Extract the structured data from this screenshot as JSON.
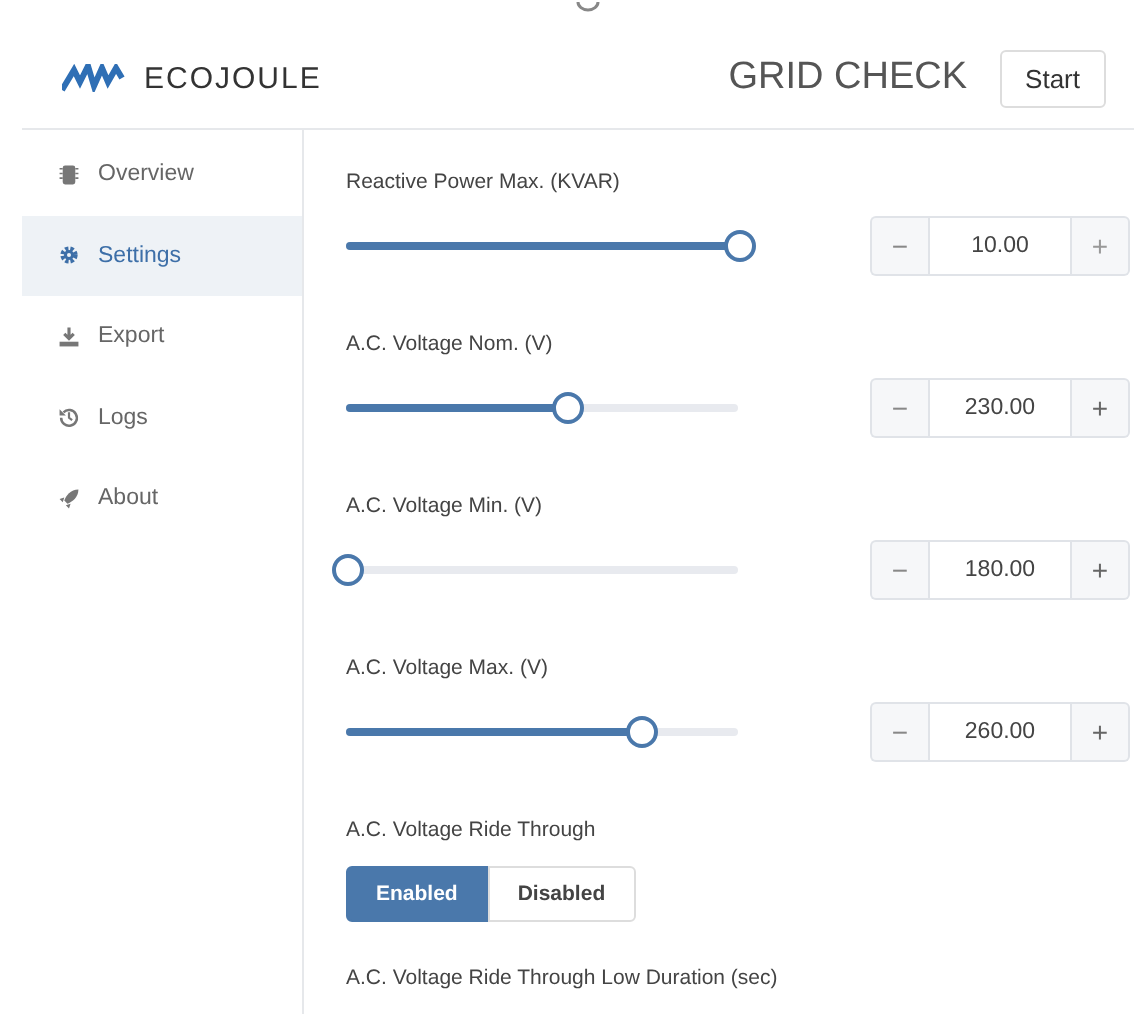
{
  "header": {
    "logo": "ECOJOULE",
    "title": "GRID CHECK",
    "start_button": "Start"
  },
  "sidebar": {
    "items": [
      {
        "label": "Overview",
        "selected": false
      },
      {
        "label": "Settings",
        "selected": true
      },
      {
        "label": "Export",
        "selected": false
      },
      {
        "label": "Logs",
        "selected": false
      },
      {
        "label": "About",
        "selected": false
      }
    ]
  },
  "settings": [
    {
      "kind": "slider",
      "label": "Reactive Power Max. (KVAR)",
      "level": 1.0,
      "value": "10.00",
      "minus": "−",
      "plus": "+",
      "plus_disabled": true
    },
    {
      "kind": "slider",
      "label": "A.C. Voltage Nom. (V)",
      "level": 0.56,
      "value": "230.00",
      "minus": "−",
      "plus": "+",
      "plus_disabled": false
    },
    {
      "kind": "slider",
      "label": "A.C. Voltage Min. (V)",
      "level": 0.0,
      "value": "180.00",
      "minus": "−",
      "plus": "+",
      "plus_disabled": false
    },
    {
      "kind": "slider",
      "label": "A.C. Voltage Max. (V)",
      "level": 0.75,
      "value": "260.00",
      "minus": "−",
      "plus": "+",
      "plus_disabled": false
    },
    {
      "kind": "toggle",
      "label": "A.C. Voltage Ride Through",
      "options": [
        {
          "label": "Enabled",
          "selected": true
        },
        {
          "label": "Disabled",
          "selected": false
        }
      ]
    },
    {
      "kind": "heading",
      "label": "A.C. Voltage Ride Through Low Duration (sec)"
    }
  ]
}
